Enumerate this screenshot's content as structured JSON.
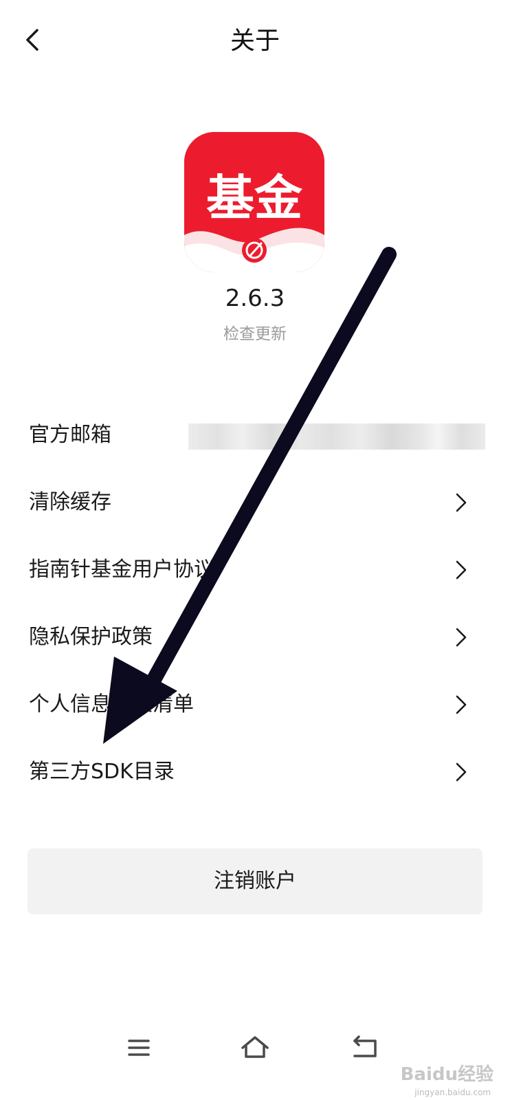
{
  "header": {
    "title": "关于",
    "back_icon": "chevron-left-icon"
  },
  "app": {
    "logo_text": "基金",
    "logo_color": "#ec1c2e",
    "version": "2.6.3",
    "check_update_label": "检查更新"
  },
  "list": {
    "items": [
      {
        "label": "官方邮箱",
        "value": "",
        "has_chevron": false
      },
      {
        "label": "清除缓存",
        "has_chevron": true
      },
      {
        "label": "指南针基金用户协议",
        "has_chevron": true
      },
      {
        "label": "隐私保护政策",
        "has_chevron": true
      },
      {
        "label": "个人信息收集清单",
        "has_chevron": true
      },
      {
        "label": "第三方SDK目录",
        "has_chevron": true
      }
    ]
  },
  "deregister_label": "注销账户",
  "bottom_nav": {
    "items": [
      "menu-icon",
      "home-icon",
      "back-icon"
    ]
  },
  "watermark": {
    "text": "Baidu经验",
    "sub": "jingyan.baidu.com"
  },
  "colors": {
    "brand_red": "#ec1c2e",
    "muted_text": "#9a9a9a",
    "button_bg": "#f2f2f2",
    "arrow": "#0c0a1e"
  }
}
